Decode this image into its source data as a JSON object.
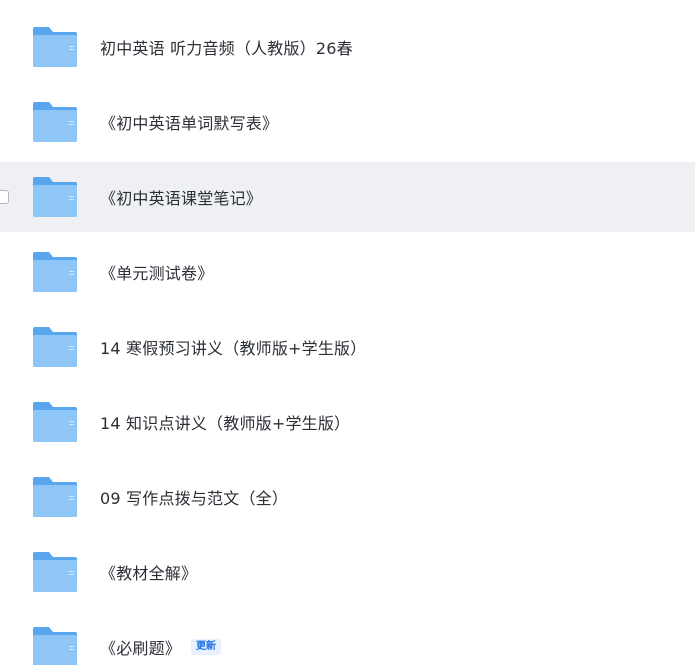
{
  "folders": [
    {
      "name": "初中英语 听力音频（人教版）26春"
    },
    {
      "name": "《初中英语单词默写表》"
    },
    {
      "name": "《初中英语课堂笔记》",
      "hovered": true
    },
    {
      "name": "《单元测试卷》"
    },
    {
      "name": "14 寒假预习讲义（教师版+学生版）"
    },
    {
      "name": "14 知识点讲义（教师版+学生版）"
    },
    {
      "name": "09 写作点拨与范文（全）"
    },
    {
      "name": "《教材全解》"
    },
    {
      "name": "《必刷题》",
      "badge": "更新"
    }
  ],
  "colors": {
    "folder_back": "#5aa6ee",
    "folder_front": "#8ec6f8",
    "hover_row": "#eef0f3",
    "badge_text": "#1f6fe5",
    "badge_bg": "#e8f1fe"
  },
  "icons": {
    "folder": "folder-icon"
  }
}
